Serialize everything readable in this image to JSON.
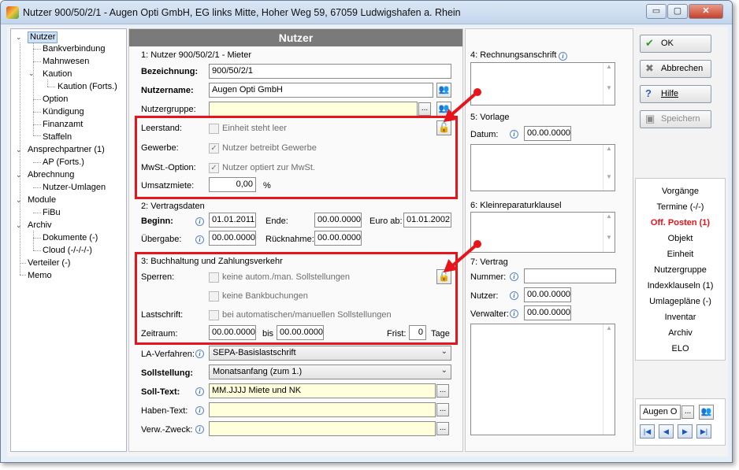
{
  "window": {
    "title": "Nutzer 900/50/2/1 - Augen Opti GmbH, EG links Mitte, Hoher Weg 59, 67059 Ludwigshafen a. Rhein",
    "min": "▭",
    "max": "▢",
    "close": "✕"
  },
  "tree": {
    "items": [
      "Nutzer",
      "Bankverbindung",
      "Mahnwesen",
      "Kaution",
      "Kaution (Forts.)",
      "Option",
      "Kündigung",
      "Finanzamt",
      "Staffeln",
      "Ansprechpartner (1)",
      "AP (Forts.)",
      "Abrechnung",
      "Nutzer-Umlagen",
      "Module",
      "FiBu",
      "Archiv",
      "Dokumente (-)",
      "Cloud (-/-/-/-)",
      "Verteiler (-)",
      "Memo"
    ]
  },
  "header": {
    "title": "Nutzer"
  },
  "sec1": {
    "title": "1: Nutzer 900/50/2/1 - Mieter",
    "bez_label": "Bezeichnung:",
    "bez_value": "900/50/2/1",
    "name_label": "Nutzername:",
    "name_value": "Augen Opti GmbH",
    "gruppe_label": "Nutzergruppe:",
    "gruppe_value": "",
    "dots": "..."
  },
  "leer": {
    "leer_label": "Leerstand:",
    "leer_cb": "Einheit steht leer",
    "gew_label": "Gewerbe:",
    "gew_cb": "Nutzer betreibt Gewerbe",
    "mwst_label": "MwSt.-Option:",
    "mwst_cb": "Nutzer optiert zur MwSt.",
    "ums_label": "Umsatzmiete:",
    "ums_value": "0,00",
    "ums_unit": "%",
    "check": "✓"
  },
  "sec2": {
    "title": "2: Vertragsdaten",
    "beginn_label": "Beginn:",
    "beginn_value": "01.01.2011",
    "ende_label": "Ende:",
    "ende_value": "00.00.0000",
    "euro_label": "Euro ab:",
    "euro_value": "01.01.2002",
    "ueber_label": "Übergabe:",
    "ueber_value": "00.00.0000",
    "rueck_label": "Rücknahme:",
    "rueck_value": "00.00.0000"
  },
  "sec3": {
    "title": "3: Buchhaltung und Zahlungsverkehr",
    "sperren_label": "Sperren:",
    "cb1": "keine autom./man. Sollstellungen",
    "cb2": "keine Bankbuchungen",
    "last_label": "Lastschrift:",
    "cb3": "bei automatischen/manuellen Sollstellungen",
    "zeit_label": "Zeitraum:",
    "von_value": "00.00.0000",
    "bis_label": "bis",
    "bis_value": "00.00.0000",
    "frist_label": "Frist:",
    "frist_value": "0",
    "tage_label": "Tage"
  },
  "bottom": {
    "la_label": "LA-Verfahren:",
    "la_value": "SEPA-Basislastschrift",
    "soll_label": "Sollstellung:",
    "soll_value": "Monatsanfang (zum 1.)",
    "solltext_label": "Soll-Text:",
    "solltext_value": "MM.JJJJ Miete und NK",
    "haben_label": "Haben-Text:",
    "haben_value": "",
    "verw_label": "Verw.-Zweck:",
    "verw_value": ""
  },
  "mid": {
    "rech_title": "4: Rechnungsanschrift",
    "vorlage_title": "5: Vorlage",
    "datum_label": "Datum:",
    "datum_value": "00.00.0000",
    "klein_title": "6: Kleinreparaturklausel",
    "vertrag_title": "7: Vertrag",
    "nummer_label": "Nummer:",
    "nummer_value": "",
    "nutzer_label": "Nutzer:",
    "nutzer_value": "00.00.0000",
    "verw_label": "Verwalter:",
    "verw_value": "00.00.0000"
  },
  "buttons": {
    "ok": "OK",
    "abbrechen": "Abbrechen",
    "hilfe": "Hilfe",
    "speichern": "Speichern"
  },
  "links": [
    "Vorgänge",
    "Termine (-/-)",
    "Off. Posten (1)",
    "Objekt",
    "Einheit",
    "Nutzergruppe",
    "Indexklauseln (1)",
    "Umlagepläne (-)",
    "Inventar",
    "Archiv",
    "ELO"
  ],
  "nav": {
    "search_value": "Augen O",
    "first": "|◀",
    "prev": "◀",
    "next": "▶",
    "last": "▶|"
  },
  "colors": {
    "accent_red": "#e8141b",
    "header_gray": "#7a7a7a",
    "field_yellow": "#ffffdc"
  }
}
